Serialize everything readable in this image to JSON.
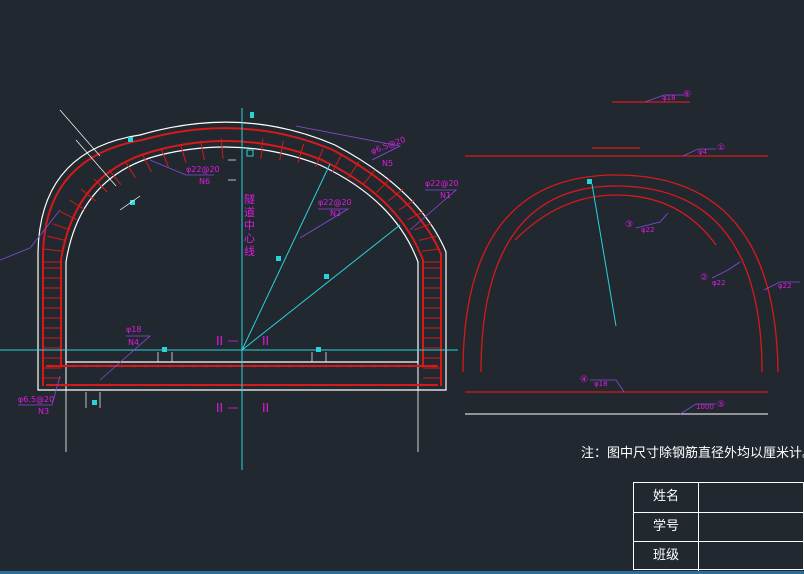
{
  "colors": {
    "background": "#212830",
    "outline": "#ffffff",
    "rebar": "#d51a1a",
    "centerline": "#29d3d8",
    "annotation": "#e21ae0",
    "leader": "#8a4bd8"
  },
  "tunnel_section": {
    "centerline_label": "隧道中心线",
    "section_marks": [
      "II",
      "II",
      "II",
      "II"
    ],
    "rebar_labels": {
      "crown_main": "φ22@20",
      "crown_main_no": "N6",
      "arch_main": "φ22@20",
      "arch_main_no": "N2",
      "right_main": "φ22@20",
      "right_main_no": "N1",
      "dist_top": "φ6.5@20",
      "dist_top_no": "N5",
      "invert": "φ18",
      "invert_no": "N4",
      "left_foot": "φ6.5@20",
      "left_foot_no": "N3"
    }
  },
  "bar_details": {
    "bar1": {
      "label": "φ4",
      "mark": "①"
    },
    "bar2": {
      "label": "φ22",
      "mark": "②"
    },
    "bar3": {
      "label": "φ22",
      "mark": "③"
    },
    "bar4": {
      "label": "φ18",
      "mark": "④"
    },
    "bar5": {
      "label": "φ22",
      "mark": "⑤"
    },
    "bar6": {
      "label": "φ18",
      "mark": "⑥"
    },
    "bar7": {
      "label": "φ22"
    },
    "bar8": {
      "label": "1000",
      "mark": "⑤"
    }
  },
  "note": "注：图中尺寸除钢筋直径外均以厘米计。",
  "title_block": [
    {
      "label": "姓名",
      "value": ""
    },
    {
      "label": "学号",
      "value": ""
    },
    {
      "label": "班级",
      "value": ""
    }
  ]
}
